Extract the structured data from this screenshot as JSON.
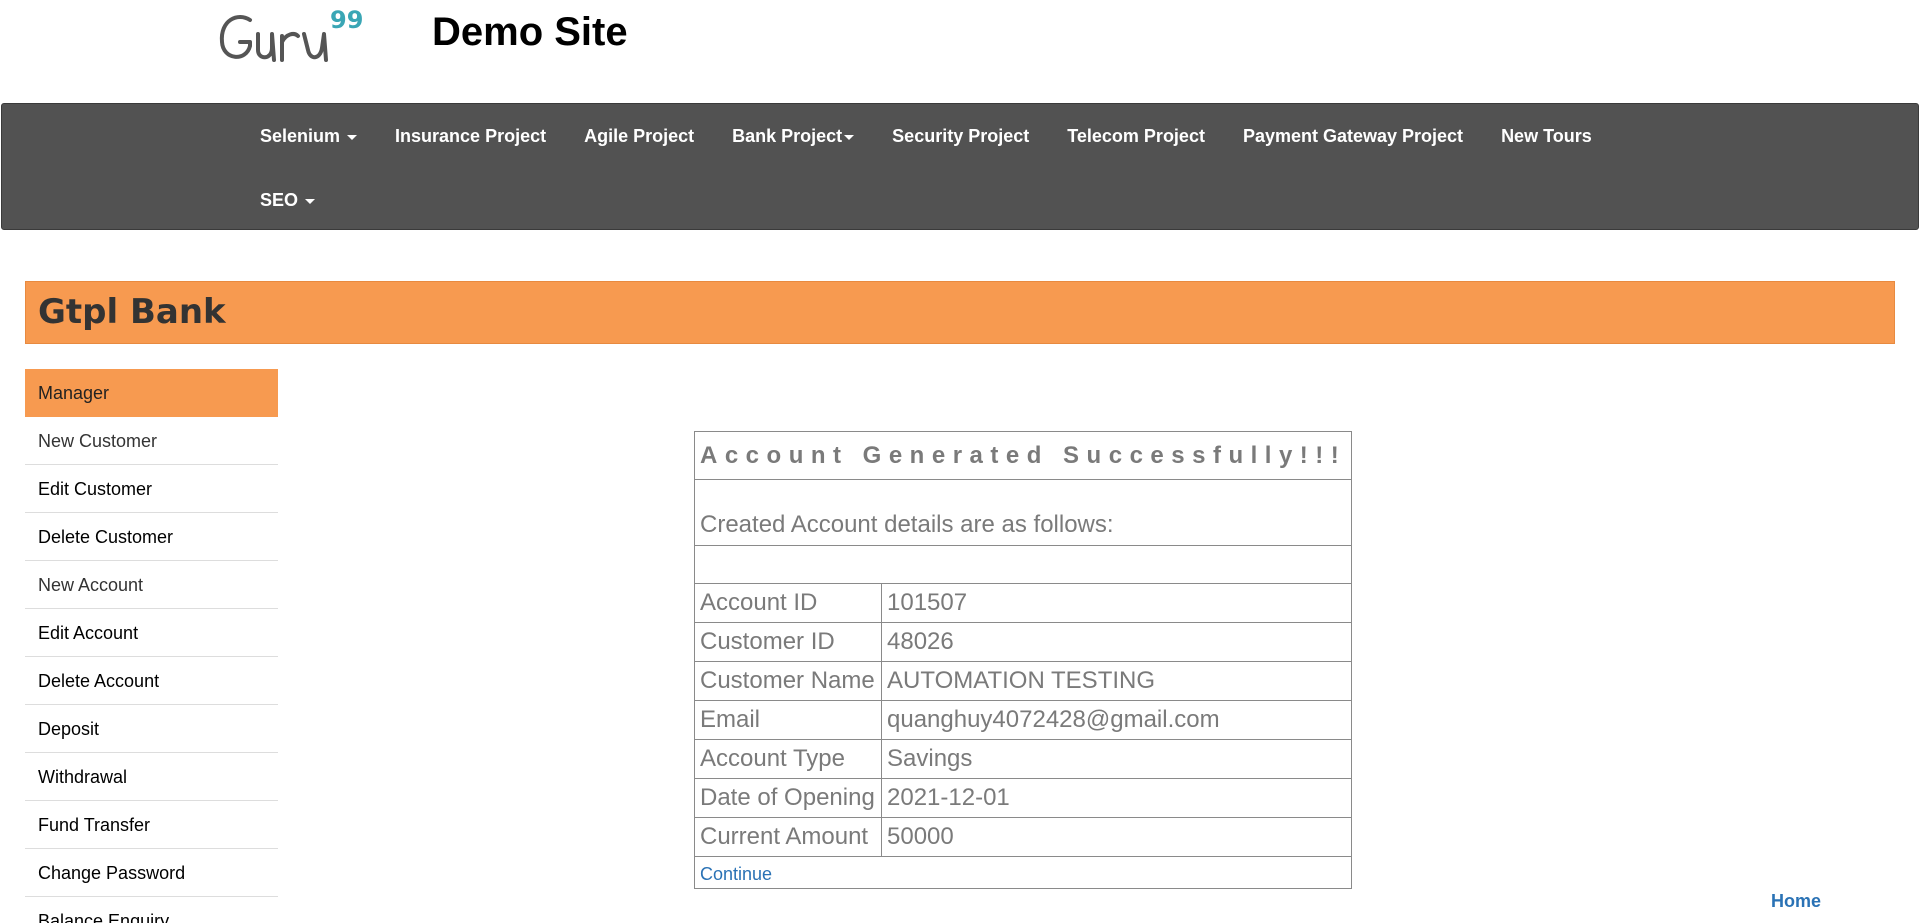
{
  "header": {
    "logo_text": "Guru",
    "logo_sup": "99",
    "site_title": "Demo Site"
  },
  "nav": {
    "row1": [
      {
        "label": "Selenium",
        "dropdown": true
      },
      {
        "label": "Insurance Project",
        "dropdown": false
      },
      {
        "label": "Agile Project",
        "dropdown": false
      },
      {
        "label": "Bank Project",
        "dropdown": true
      },
      {
        "label": "Security Project",
        "dropdown": false
      },
      {
        "label": "Telecom Project",
        "dropdown": false
      },
      {
        "label": "Payment Gateway Project",
        "dropdown": false
      },
      {
        "label": "New Tours",
        "dropdown": false
      }
    ],
    "row2": [
      {
        "label": "SEO",
        "dropdown": true
      }
    ]
  },
  "bank": {
    "title": "Gtpl Bank"
  },
  "sidebar": {
    "items": [
      {
        "label": "Manager"
      },
      {
        "label": "New Customer"
      },
      {
        "label": "Edit Customer"
      },
      {
        "label": "Delete Customer"
      },
      {
        "label": "New Account"
      },
      {
        "label": "Edit Account"
      },
      {
        "label": "Delete Account"
      },
      {
        "label": "Deposit"
      },
      {
        "label": "Withdrawal"
      },
      {
        "label": "Fund Transfer"
      },
      {
        "label": "Change Password"
      },
      {
        "label": "Balance Enquiry"
      }
    ]
  },
  "result": {
    "success_message": "Account Generated Successfully!!!",
    "details_heading": "Created Account details are as follows:",
    "rows": [
      {
        "label": "Account ID",
        "value": "101507"
      },
      {
        "label": "Customer ID",
        "value": "48026"
      },
      {
        "label": "Customer Name",
        "value": "AUTOMATION TESTING"
      },
      {
        "label": "Email",
        "value": "quanghuy4072428@gmail.com"
      },
      {
        "label": "Account Type",
        "value": "Savings"
      },
      {
        "label": "Date of Opening",
        "value": "2021-12-01"
      },
      {
        "label": "Current Amount",
        "value": "50000"
      }
    ],
    "continue_label": "Continue"
  },
  "footer": {
    "home_label": "Home"
  },
  "colors": {
    "navbar_bg": "#525252",
    "accent_orange": "#f79a50",
    "success_green": "#4e7a1c",
    "link_blue": "#2a72b5",
    "logo_teal": "#3aa6b5"
  }
}
